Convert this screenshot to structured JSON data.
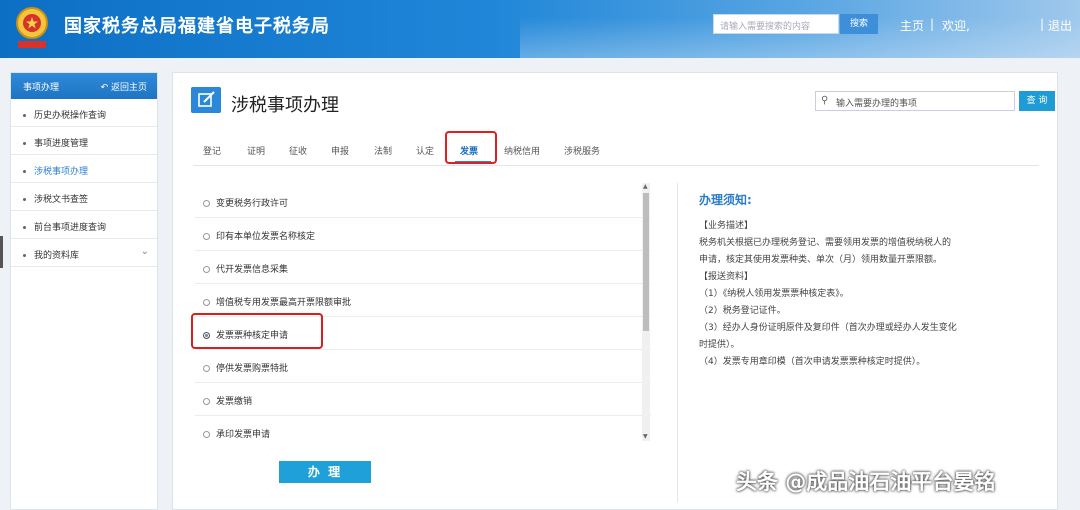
{
  "header": {
    "title": "国家税务总局福建省电子税务局",
    "search_placeholder": "请输入需要搜索的内容",
    "search_button": "搜索",
    "nav_home": "主页",
    "nav_welcome": "欢迎,",
    "nav_exit": "退出",
    "nav_separator": "|"
  },
  "sidebar": {
    "title": "事项办理",
    "back_label": "返回主页",
    "items": [
      {
        "label": "历史办税操作查询"
      },
      {
        "label": "事项进度管理"
      },
      {
        "label": "涉税事项办理"
      },
      {
        "label": "涉税文书查签"
      },
      {
        "label": "前台事项进度查询"
      },
      {
        "label": "我的资料库"
      }
    ]
  },
  "main": {
    "page_title": "涉税事项办理",
    "search_placeholder": "输入需要办理的事项",
    "query_button": "查 询",
    "tabs": [
      {
        "label": "登记"
      },
      {
        "label": "证明"
      },
      {
        "label": "征收"
      },
      {
        "label": "申报"
      },
      {
        "label": "法制"
      },
      {
        "label": "认定"
      },
      {
        "label": "发票"
      },
      {
        "label": "纳税信用"
      },
      {
        "label": "涉税服务"
      }
    ],
    "active_tab": "发票",
    "items": [
      {
        "label": "变更税务行政许可",
        "checked": false
      },
      {
        "label": "印有本单位发票名称核定",
        "checked": false
      },
      {
        "label": "代开发票信息采集",
        "checked": false
      },
      {
        "label": "增值税专用发票最高开票限额审批",
        "checked": false
      },
      {
        "label": "发票票种核定申请",
        "checked": true
      },
      {
        "label": "停供发票购票特批",
        "checked": false
      },
      {
        "label": "发票缴销",
        "checked": false
      },
      {
        "label": "承印发票申请",
        "checked": false
      }
    ],
    "handle_button": "办 理",
    "notice": {
      "title": "办理须知:",
      "lines": [
        "【业务描述】",
        "税务机关根据已办理税务登记、需要领用发票的增值税纳税人的",
        "申请，核定其使用发票种类、单次（月）领用数量开票限额。",
        "【报送资料】",
        "（1）《纳税人领用发票票种核定表》。",
        "（2）税务登记证件。",
        "（3）经办人身份证明原件及复印件（首次办理或经办人发生变化",
        "时提供）。",
        "（4）发票专用章印模（首次申请发票票种核定时提供）。"
      ]
    }
  },
  "watermark": "头条 @成品油石油平台晏铭",
  "colors": {
    "brand_blue": "#1e74c3",
    "highlight_red": "#e02020",
    "button_cyan": "#1fa0d9"
  }
}
